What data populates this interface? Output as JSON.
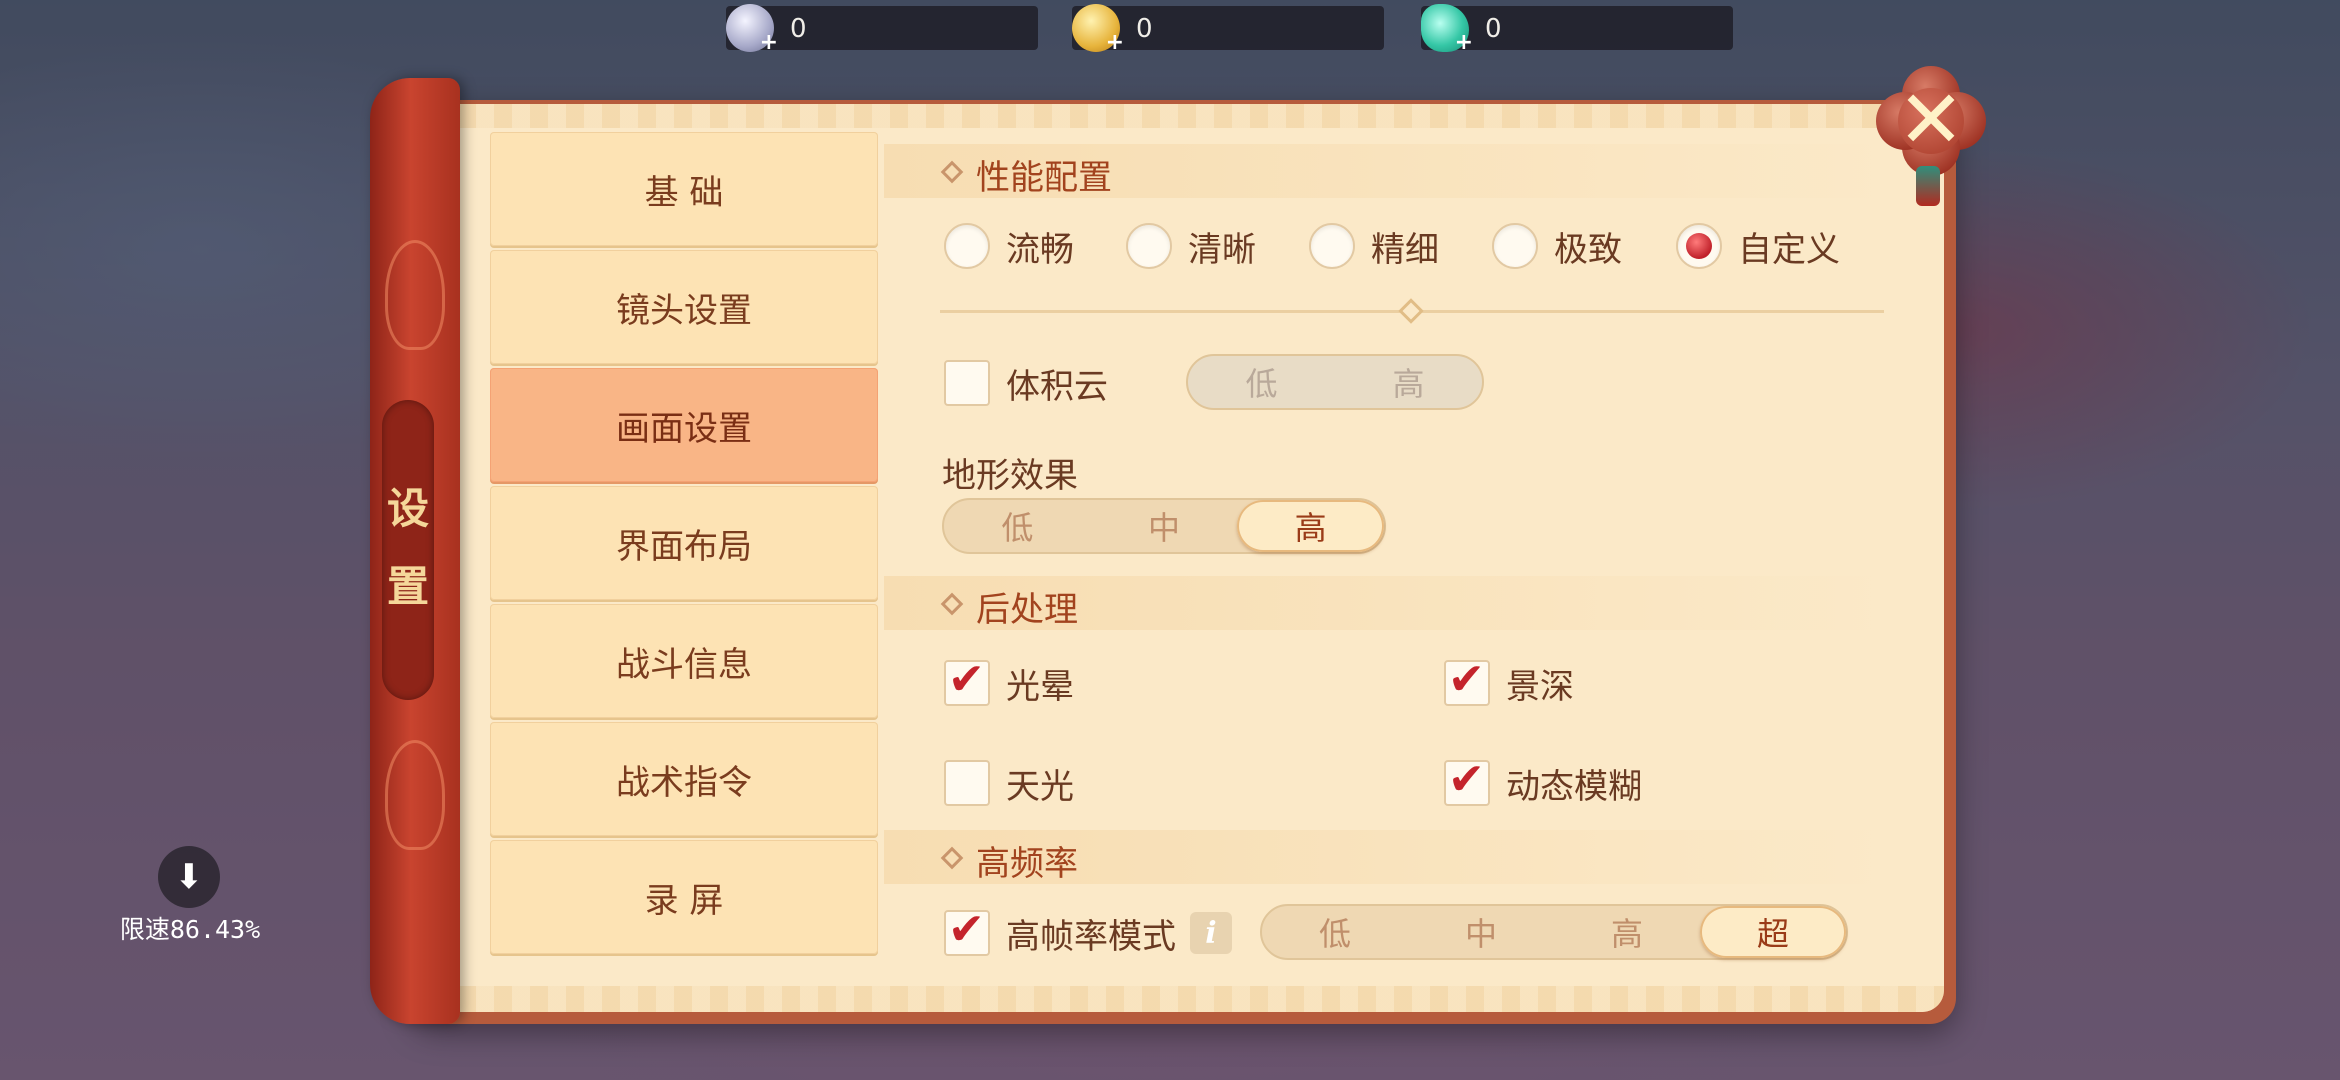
{
  "currencies": [
    {
      "icon": "silver-coin-icon",
      "value": "0"
    },
    {
      "icon": "gold-coin-icon",
      "value": "0"
    },
    {
      "icon": "jade-icon",
      "value": "0"
    }
  ],
  "scroll_title": "设置",
  "nav": {
    "items": [
      "基 础",
      "镜头设置",
      "画面设置",
      "界面布局",
      "战斗信息",
      "战术指令",
      "录 屏"
    ],
    "active_index": 2
  },
  "performance": {
    "title": "性能配置",
    "options": [
      "流畅",
      "清晰",
      "精细",
      "极致",
      "自定义"
    ],
    "selected": "自定义"
  },
  "volumetric_cloud": {
    "label": "体积云",
    "checked": false,
    "options": [
      "低",
      "高"
    ],
    "selected": null,
    "enabled": false
  },
  "terrain": {
    "label": "地形效果",
    "options": [
      "低",
      "中",
      "高"
    ],
    "selected": "高"
  },
  "post_processing": {
    "title": "后处理",
    "items": [
      {
        "label": "光晕",
        "checked": true
      },
      {
        "label": "景深",
        "checked": true
      },
      {
        "label": "天光",
        "checked": false
      },
      {
        "label": "动态模糊",
        "checked": true
      }
    ]
  },
  "high_frequency": {
    "title": "高频率",
    "mode_label": "高帧率模式",
    "checked": true,
    "info_icon": "info-icon",
    "options": [
      "低",
      "中",
      "高",
      "超"
    ],
    "selected": "超"
  },
  "download": {
    "text": "限速86.43%"
  },
  "colors": {
    "accent_red": "#c4242c",
    "panel": "#fbe9c8",
    "active_tab": "#f9b586"
  }
}
